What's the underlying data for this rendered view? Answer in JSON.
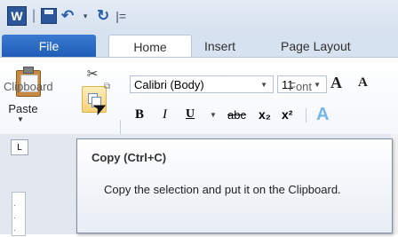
{
  "app": {
    "logo_letter": "W",
    "undo_dropdown": "▾",
    "qat_end": "|="
  },
  "tabs": [
    {
      "label": "File"
    },
    {
      "label": "Home"
    },
    {
      "label": "Insert"
    },
    {
      "label": "Page Layout"
    }
  ],
  "clipboard": {
    "paste_label": "Paste",
    "group_label": "Clipboard",
    "icons": [
      "paste-icon",
      "scissors-icon",
      "copy-icon",
      "format-painter-icon"
    ]
  },
  "font": {
    "name": "Calibri (Body)",
    "size": "11",
    "group_label": "Font",
    "grow": "A",
    "shrink": "A",
    "bold": "B",
    "italic": "I",
    "underline": "U",
    "strikethrough": "abc",
    "subscript": "x₂",
    "superscript": "x²",
    "effects": "A"
  },
  "ruler": {
    "tab_select": "L"
  },
  "tooltip": {
    "title": "Copy (Ctrl+C)",
    "description": "Copy the selection and put it on the Clipboard."
  },
  "colors": {
    "file_tab": "#2b66c2",
    "copy_hover": "#f8d27a",
    "ribbon_bg": "#f4f7fb"
  }
}
